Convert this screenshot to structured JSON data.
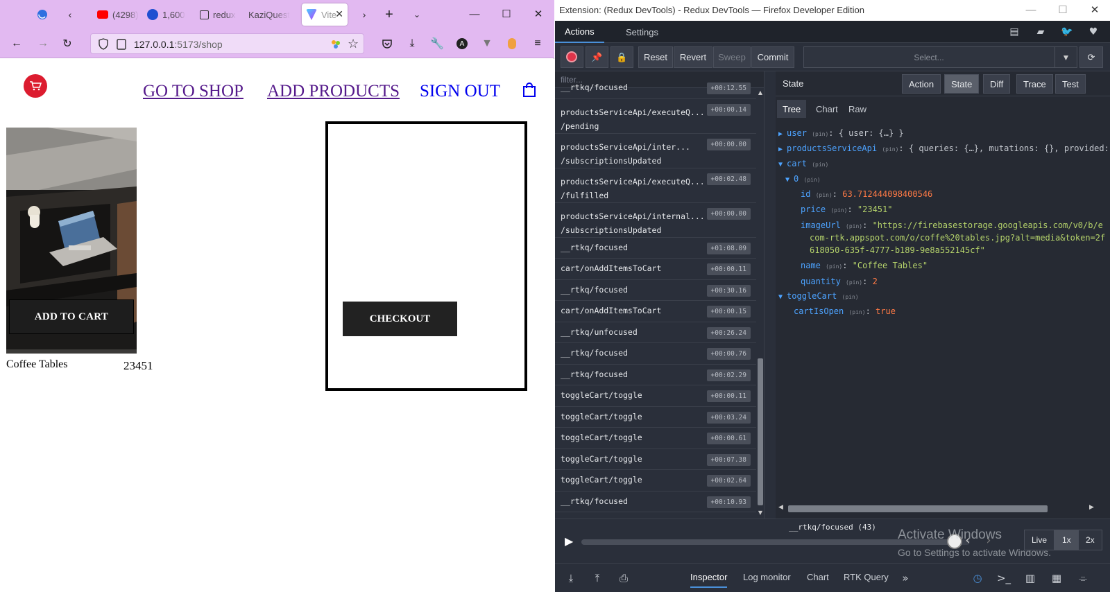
{
  "browser": {
    "tabs": [
      {
        "label": "(4298)",
        "color": "#ff0000"
      },
      {
        "label": "1,600",
        "color": "#1f4fd1"
      },
      {
        "label": "redux",
        "color": "#333333"
      },
      {
        "label": "KaziQuest",
        "color": "#8e6bbf"
      },
      {
        "label": "Vite",
        "color": "#bd34fe"
      }
    ],
    "url_host": "127.0.0.1",
    "url_rest": ":5173/shop"
  },
  "page": {
    "nav": {
      "shop": "GO TO SHOP",
      "add": "ADD PRODUCTS",
      "signout": "SIGN OUT"
    },
    "product": {
      "add_to_cart": "ADD TO CART",
      "name": "Coffee Tables",
      "price": "23451"
    },
    "checkout": "CHECKOUT"
  },
  "devtools": {
    "window_title": "Extension: (Redux DevTools) - Redux DevTools — Firefox Developer Edition",
    "tabs": [
      "Actions",
      "Settings"
    ],
    "toolbar": {
      "reset": "Reset",
      "revert": "Revert",
      "sweep": "Sweep",
      "commit": "Commit",
      "select_placeholder": "Select..."
    },
    "filter_placeholder": "filter...",
    "actions": [
      {
        "name": "__rtkq/focused",
        "time": "+00:12.55"
      },
      {
        "name": "productsServiceApi/executeQ...\n/pending",
        "time": "+00:00.14"
      },
      {
        "name": "productsServiceApi/inter...\n/subscriptionsUpdated",
        "time": "+00:00.00"
      },
      {
        "name": "productsServiceApi/executeQ...\n/fulfilled",
        "time": "+00:02.48"
      },
      {
        "name": "productsServiceApi/internal...\n/subscriptionsUpdated",
        "time": "+00:00.00"
      },
      {
        "name": "__rtkq/focused",
        "time": "+01:08.09"
      },
      {
        "name": "cart/onAddItemsToCart",
        "time": "+00:00.11"
      },
      {
        "name": "__rtkq/focused",
        "time": "+00:30.16"
      },
      {
        "name": "cart/onAddItemsToCart",
        "time": "+00:00.15"
      },
      {
        "name": "__rtkq/unfocused",
        "time": "+00:26.24"
      },
      {
        "name": "__rtkq/focused",
        "time": "+00:00.76"
      },
      {
        "name": "__rtkq/focused",
        "time": "+00:02.29"
      },
      {
        "name": "toggleCart/toggle",
        "time": "+00:00.11"
      },
      {
        "name": "toggleCart/toggle",
        "time": "+00:03.24"
      },
      {
        "name": "toggleCart/toggle",
        "time": "+00:00.61"
      },
      {
        "name": "toggleCart/toggle",
        "time": "+00:07.38"
      },
      {
        "name": "toggleCart/toggle",
        "time": "+00:02.64"
      },
      {
        "name": "__rtkq/focused",
        "time": "+00:10.93"
      }
    ],
    "state_label": "State",
    "monitor_buttons": [
      "Action",
      "State",
      "Diff",
      "Trace",
      "Test"
    ],
    "sub_tabs": [
      "Tree",
      "Chart",
      "Raw"
    ],
    "tree": {
      "user_key": "user",
      "user_val": "{ user: {…} }",
      "api_key": "productsServiceApi",
      "api_val": "{ queries: {…}, mutations: {}, provided:",
      "cart_key": "cart",
      "idx_key": "0",
      "id_key": "id",
      "id_val": "63.712444098400546",
      "price_key": "price",
      "price_val": "\"23451\"",
      "img_key": "imageUrl",
      "img_line1": "\"https://firebasestorage.googleapis.com/v0/b/e",
      "img_line2": "com-rtk.appspot.com/o/coffe%20tables.jpg?alt=media&token=2f",
      "img_line3": "618050-635f-4777-b189-9e8a552145cf\"",
      "name_key": "name",
      "name_val": "\"Coffee Tables\"",
      "qty_key": "quantity",
      "qty_val": "2",
      "toggle_key": "toggleCart",
      "open_key": "cartIsOpen",
      "open_val": "true",
      "pin": "(pin)"
    },
    "slider": {
      "current": "__rtkq/focused (43)",
      "position": 0.96,
      "live": "Live",
      "x1": "1x",
      "x2": "2x"
    },
    "watermark": {
      "line1": "Activate Windows",
      "line2": "Go to Settings to activate Windows."
    },
    "bottom_tabs": [
      "Inspector",
      "Log monitor",
      "Chart",
      "RTK Query"
    ]
  }
}
